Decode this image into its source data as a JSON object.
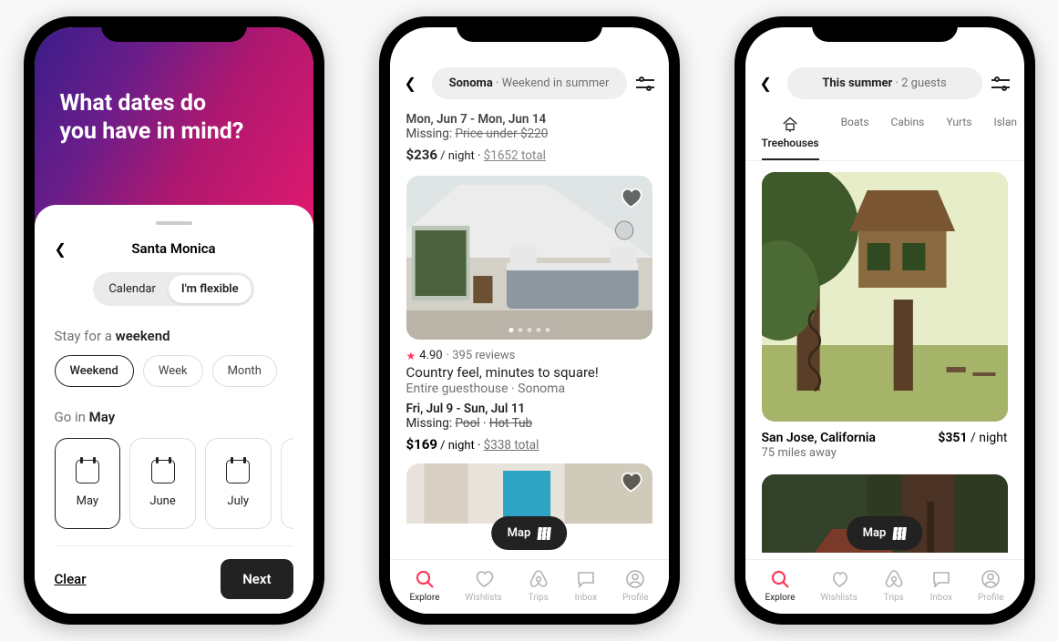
{
  "phone1": {
    "heading_l1": "What dates do",
    "heading_l2": "you have in mind?",
    "location": "Santa Monica",
    "seg_calendar": "Calendar",
    "seg_flexible": "I'm flexible",
    "stay_prefix": "Stay for a ",
    "stay_bold": "weekend",
    "chips": {
      "weekend": "Weekend",
      "week": "Week",
      "month": "Month"
    },
    "go_prefix": "Go in ",
    "go_bold": "May",
    "months": {
      "may": "May",
      "june": "June",
      "july": "July"
    },
    "clear_label": "Clear",
    "next_label": "Next"
  },
  "phone2": {
    "search_loc": "Sonoma",
    "search_sep": " · ",
    "search_dates": "Weekend in summer",
    "top_listing": {
      "dates": "Mon, Jun 7 - Mon, Jun 14",
      "missing_prefix": "Missing: ",
      "missing_strike": "Price under $220",
      "price": "$236",
      "per": " / night · ",
      "total": "$1652 total"
    },
    "mid_listing": {
      "rating": "4.90",
      "reviews": " · 395 reviews",
      "title": "Country feel, minutes to square!",
      "subtitle": "Entire guesthouse · Sonoma",
      "dates": "Fri, Jul 9 - Sun, Jul 11",
      "missing_prefix": "Missing: ",
      "missing_strike1": "Pool",
      "missing_sep": " · ",
      "missing_strike2": "Hot Tub",
      "price": "$169",
      "per": " / night · ",
      "total": "$338 total"
    },
    "map_label": "Map",
    "tabs": {
      "explore": "Explore",
      "wishlists": "Wishlists",
      "trips": "Trips",
      "inbox": "Inbox",
      "profile": "Profile"
    }
  },
  "phone3": {
    "search_l1": "This summer",
    "search_sep": " · ",
    "search_l2": "2 guests",
    "cats": {
      "treehouses": "Treehouses",
      "boats": "Boats",
      "cabins": "Cabins",
      "yurts": "Yurts",
      "islands": "Islan"
    },
    "listing": {
      "loc": "San Jose, California",
      "price": "$351",
      "per": " / night",
      "sub": "75 miles away"
    },
    "map_label": "Map",
    "tabs": {
      "explore": "Explore",
      "wishlists": "Wishlists",
      "trips": "Trips",
      "inbox": "Inbox",
      "profile": "Profile"
    }
  }
}
